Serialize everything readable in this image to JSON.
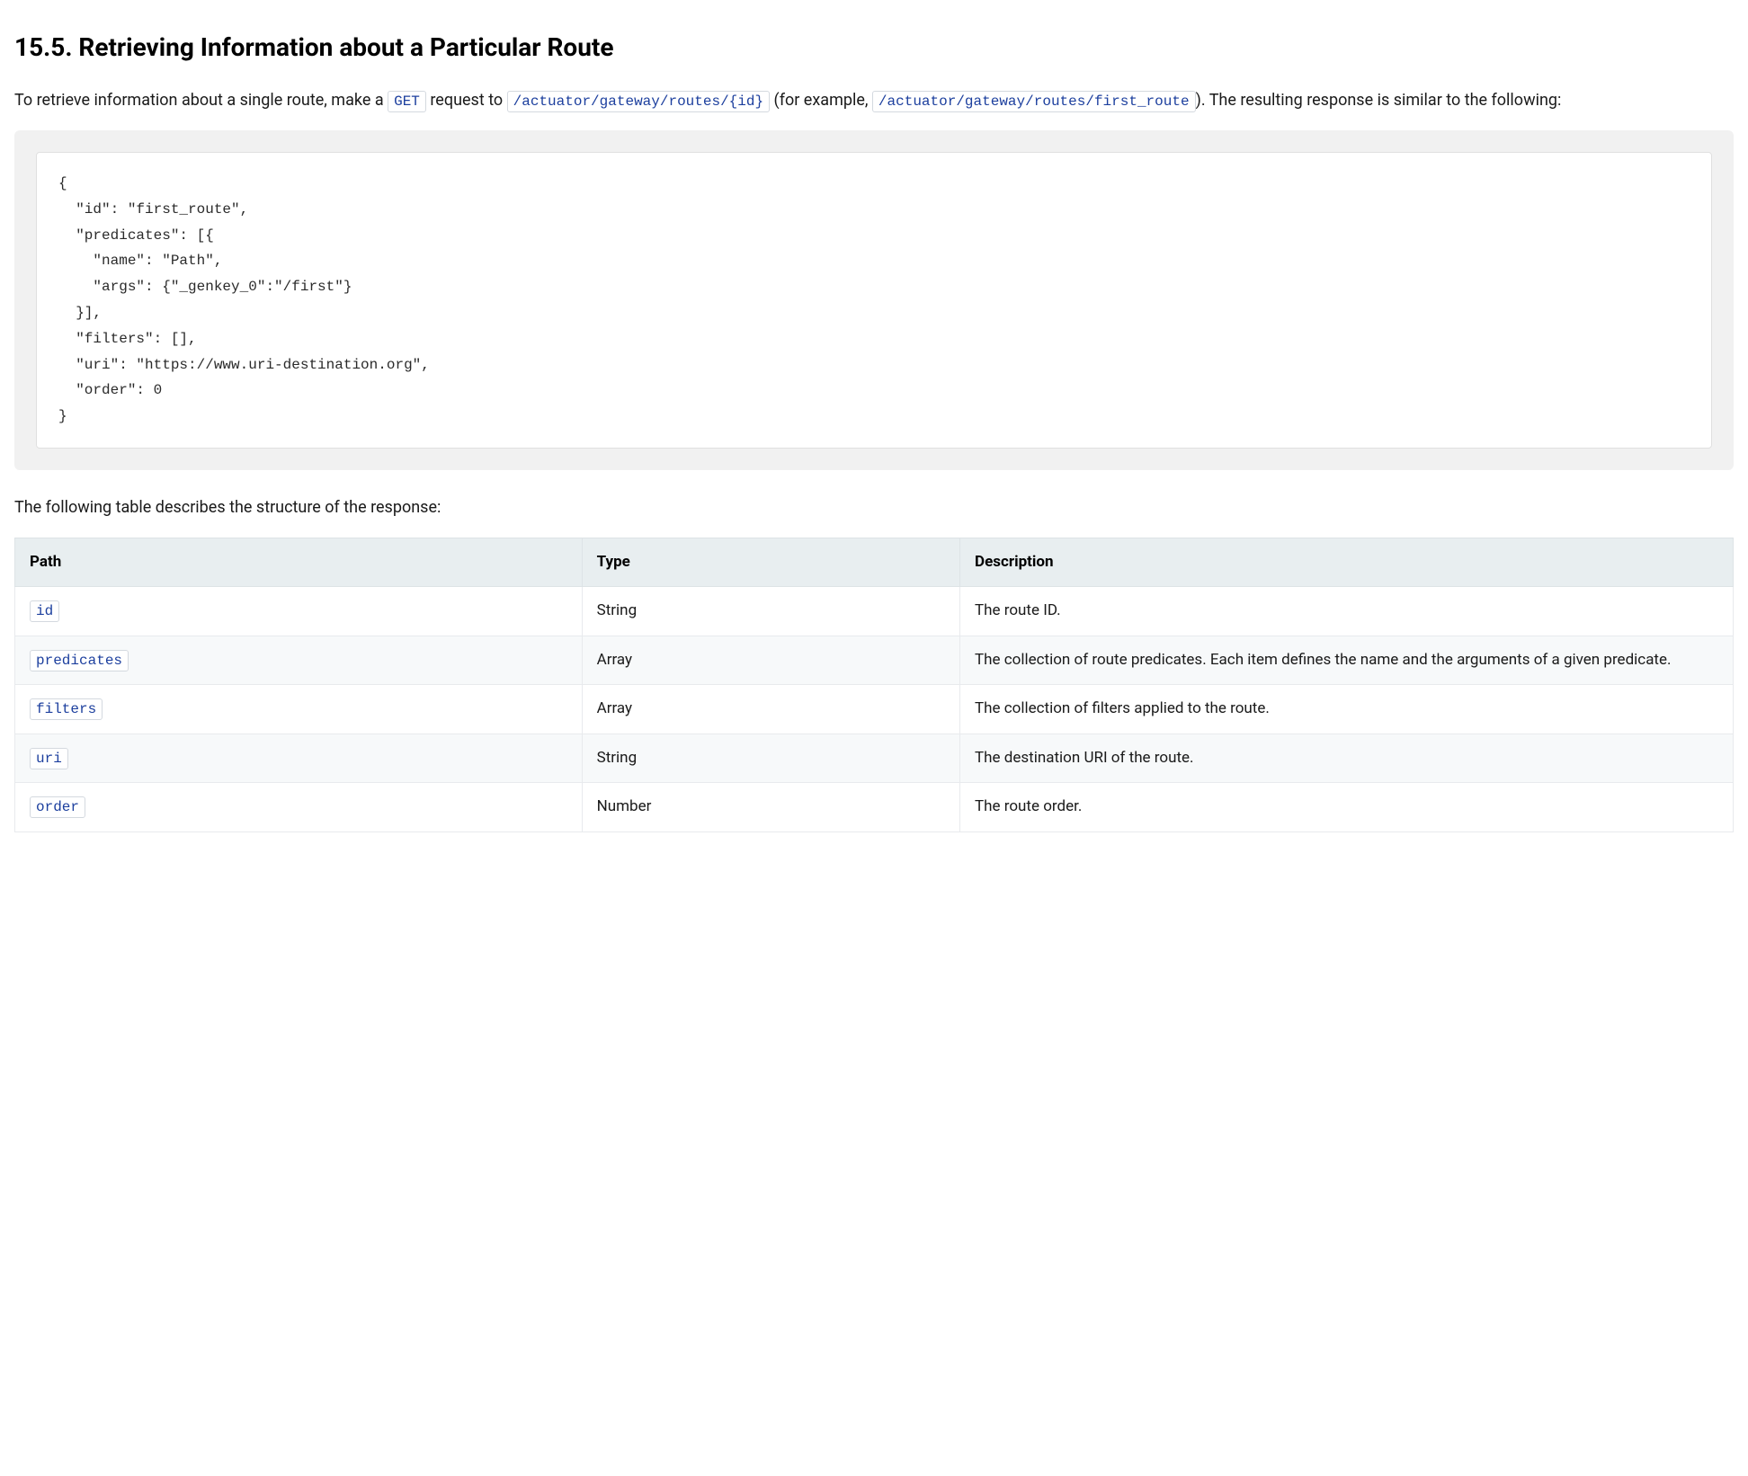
{
  "heading": "15.5. Retrieving Information about a Particular Route",
  "intro": {
    "part1": "To retrieve information about a single route, make a ",
    "code_get": "GET",
    "part2": " request to ",
    "code_path": "/actuator/gateway/routes/{id}",
    "part3": " (for example, ",
    "code_example": "/actuator/gateway/routes/first_route",
    "part4": "). The resulting response is similar to the following:"
  },
  "code_block": "{\n  \"id\": \"first_route\",\n  \"predicates\": [{\n    \"name\": \"Path\",\n    \"args\": {\"_genkey_0\":\"/first\"}\n  }],\n  \"filters\": [],\n  \"uri\": \"https://www.uri-destination.org\",\n  \"order\": 0\n}",
  "table_intro": "The following table describes the structure of the response:",
  "table": {
    "headers": {
      "path": "Path",
      "type": "Type",
      "description": "Description"
    },
    "rows": [
      {
        "path": "id",
        "type": "String",
        "description": "The route ID."
      },
      {
        "path": "predicates",
        "type": "Array",
        "description": "The collection of route predicates. Each item defines the name and the arguments of a given predicate."
      },
      {
        "path": "filters",
        "type": "Array",
        "description": "The collection of filters applied to the route."
      },
      {
        "path": "uri",
        "type": "String",
        "description": "The destination URI of the route."
      },
      {
        "path": "order",
        "type": "Number",
        "description": "The route order."
      }
    ]
  }
}
